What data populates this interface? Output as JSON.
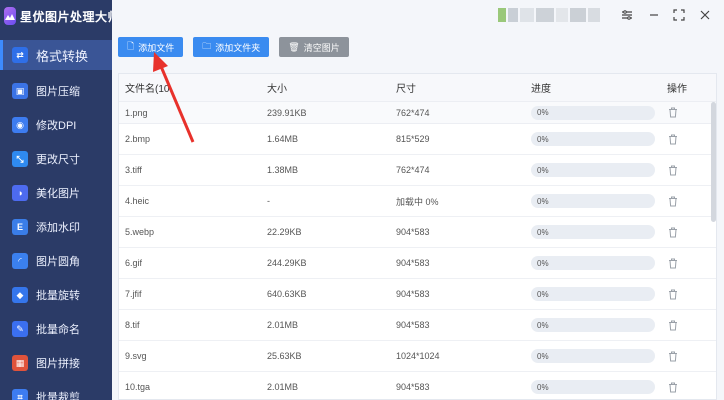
{
  "app": {
    "title": "星优图片处理大师"
  },
  "sidebar": {
    "items": [
      {
        "label": "格式转换",
        "icon": "convert-icon",
        "color": "#2f6fe8",
        "glyph": "⇄"
      },
      {
        "label": "图片压缩",
        "icon": "compress-icon",
        "color": "#3b73e6",
        "glyph": "▣"
      },
      {
        "label": "修改DPI",
        "icon": "dpi-icon",
        "color": "#3d7cf0",
        "glyph": "◉"
      },
      {
        "label": "更改尺寸",
        "icon": "resize-icon",
        "color": "#2f8af0",
        "glyph": "⤡"
      },
      {
        "label": "美化图片",
        "icon": "beautify-icon",
        "color": "#4d6bf0",
        "glyph": "◑"
      },
      {
        "label": "添加水印",
        "icon": "watermark-icon",
        "color": "#3a7de8",
        "glyph": "E"
      },
      {
        "label": "图片圆角",
        "icon": "round-corner-icon",
        "color": "#3b80ee",
        "glyph": "◜"
      },
      {
        "label": "批量旋转",
        "icon": "rotate-icon",
        "color": "#3576ec",
        "glyph": "◆"
      },
      {
        "label": "批量命名",
        "icon": "rename-icon",
        "color": "#3b6ff0",
        "glyph": "✎"
      },
      {
        "label": "图片拼接",
        "icon": "stitch-icon",
        "color": "#e0533b",
        "glyph": "▦"
      },
      {
        "label": "批量裁剪",
        "icon": "crop-icon",
        "color": "#3d7cf0",
        "glyph": "⌗"
      }
    ]
  },
  "toolbar": {
    "add_file": "添加文件",
    "add_folder": "添加文件夹",
    "clear": "清空图片"
  },
  "table": {
    "headers": [
      "文件名(10",
      "大小",
      "尺寸",
      "进度",
      "操作"
    ],
    "rows": [
      {
        "name": "1.png",
        "size": "239.91KB",
        "dim": "762*474",
        "progress": "0%"
      },
      {
        "name": "2.bmp",
        "size": "1.64MB",
        "dim": "815*529",
        "progress": "0%"
      },
      {
        "name": "3.tiff",
        "size": "1.38MB",
        "dim": "762*474",
        "progress": "0%"
      },
      {
        "name": "4.heic",
        "size": "-",
        "dim": "加载中 0%",
        "progress": "0%"
      },
      {
        "name": "5.webp",
        "size": "22.29KB",
        "dim": "904*583",
        "progress": "0%"
      },
      {
        "name": "6.gif",
        "size": "244.29KB",
        "dim": "904*583",
        "progress": "0%"
      },
      {
        "name": "7.jfif",
        "size": "640.63KB",
        "dim": "904*583",
        "progress": "0%"
      },
      {
        "name": "8.tif",
        "size": "2.01MB",
        "dim": "904*583",
        "progress": "0%"
      },
      {
        "name": "9.svg",
        "size": "25.63KB",
        "dim": "1024*1024",
        "progress": "0%"
      },
      {
        "name": "10.tga",
        "size": "2.01MB",
        "dim": "904*583",
        "progress": "0%"
      }
    ]
  },
  "colors": {
    "sidebar": "#2b3b67",
    "accent": "#3a8bf0",
    "arrow": "#e8312b"
  }
}
